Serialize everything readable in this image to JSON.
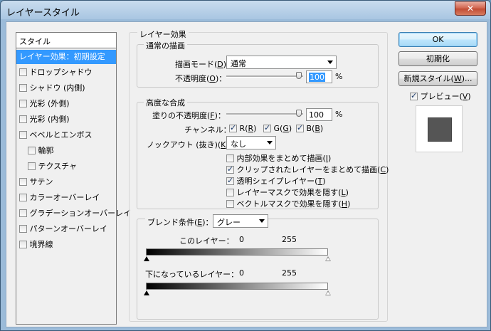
{
  "window": {
    "title": "レイヤースタイル",
    "close": "✕"
  },
  "styles": {
    "header": "スタイル",
    "items": [
      {
        "label": "レイヤー効果：初期設定",
        "selected": true,
        "checkbox": false,
        "indent": false
      },
      {
        "label": "ドロップシャドウ",
        "checkbox": true,
        "indent": false
      },
      {
        "label": "シャドウ (内側)",
        "checkbox": true,
        "indent": false
      },
      {
        "label": "光彩 (外側)",
        "checkbox": true,
        "indent": false
      },
      {
        "label": "光彩 (内側)",
        "checkbox": true,
        "indent": false
      },
      {
        "label": "ベベルとエンボス",
        "checkbox": true,
        "indent": false
      },
      {
        "label": "輪郭",
        "checkbox": true,
        "indent": true
      },
      {
        "label": "テクスチャ",
        "checkbox": true,
        "indent": true
      },
      {
        "label": "サテン",
        "checkbox": true,
        "indent": false
      },
      {
        "label": "カラーオーバーレイ",
        "checkbox": true,
        "indent": false
      },
      {
        "label": "グラデーションオーバーレイ",
        "checkbox": true,
        "indent": false
      },
      {
        "label": "パターンオーバーレイ",
        "checkbox": true,
        "indent": false
      },
      {
        "label": "境界線",
        "checkbox": true,
        "indent": false
      }
    ]
  },
  "effects": {
    "legend": "レイヤー効果",
    "normal": {
      "legend": "通常の描画",
      "blend_label": "描画モード(",
      "blend_key": "D",
      "blend_value": "通常",
      "opacity_label": "不透明度(",
      "opacity_key": "O",
      "opacity_value": "100",
      "unit": "%"
    },
    "advanced": {
      "legend": "高度な合成",
      "fill_label": "塗りの不透明度(",
      "fill_key": "F",
      "fill_value": "100",
      "unit": "%",
      "channel_label": "チャンネル：",
      "channels": [
        {
          "prefix": "R(",
          "key": "R",
          "checked": true
        },
        {
          "prefix": "G(",
          "key": "G",
          "checked": true
        },
        {
          "prefix": "B(",
          "key": "B",
          "checked": true
        }
      ],
      "knockout_label": "ノックアウト (抜き)(",
      "knockout_key": "K",
      "knockout_value": "なし",
      "options": [
        {
          "label": "内部効果をまとめて描画(",
          "key": "I",
          "checked": false
        },
        {
          "label": "クリップされたレイヤーをまとめて描画(",
          "key": "C",
          "checked": true
        },
        {
          "label": "透明シェイプレイヤー(",
          "key": "T",
          "checked": true
        },
        {
          "label": "レイヤーマスクで効果を隠す(",
          "key": "L",
          "checked": false
        },
        {
          "label": "ベクトルマスクで効果を隠す(",
          "key": "H",
          "checked": false
        }
      ]
    },
    "blend_if": {
      "label": "ブレンド条件(",
      "key": "E",
      "value": "グレー",
      "this_layer": {
        "label": "このレイヤー：",
        "low": "0",
        "high": "255"
      },
      "underlying": {
        "label": "下になっているレイヤー：",
        "low": "0",
        "high": "255"
      }
    }
  },
  "buttons": {
    "ok": "OK",
    "reset": "初期化",
    "new_style_prefix": "新規スタイル(",
    "new_style_key": "W",
    "new_style_suffix": ")...",
    "preview_prefix": "プレビュー(",
    "preview_key": "V",
    "preview_checked": true
  }
}
